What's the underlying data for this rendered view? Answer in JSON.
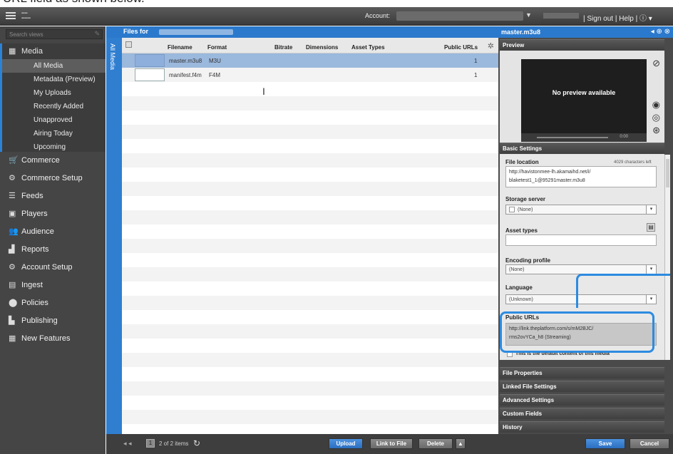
{
  "caption": "URL field as shown below.",
  "topbar": {
    "account_label": "Account:",
    "links": "| Sign out | Help | ⓘ ▾"
  },
  "sidebar": {
    "search_placeholder": "Search views",
    "media_label": "Media",
    "media_items": [
      {
        "label": "All Media",
        "active": true
      },
      {
        "label": "Metadata (Preview)"
      },
      {
        "label": "My Uploads"
      },
      {
        "label": "Recently Added"
      },
      {
        "label": "Unapproved"
      },
      {
        "label": "Airing Today"
      },
      {
        "label": "Upcoming"
      }
    ],
    "sections": [
      {
        "label": "Commerce",
        "icon": "cart-icon",
        "glyph": "🛒"
      },
      {
        "label": "Commerce Setup",
        "icon": "gear-icon",
        "glyph": "⚙"
      },
      {
        "label": "Feeds",
        "icon": "rss-icon",
        "glyph": "☰"
      },
      {
        "label": "Players",
        "icon": "player-icon",
        "glyph": "▣"
      },
      {
        "label": "Audience",
        "icon": "audience-icon",
        "glyph": "👥"
      },
      {
        "label": "Reports",
        "icon": "chart-icon",
        "glyph": "▟"
      },
      {
        "label": "Account Setup",
        "icon": "gear-icon",
        "glyph": "⚙"
      },
      {
        "label": "Ingest",
        "icon": "ingest-icon",
        "glyph": "▤"
      },
      {
        "label": "Policies",
        "icon": "policy-icon",
        "glyph": "⬤"
      },
      {
        "label": "Publishing",
        "icon": "publish-icon",
        "glyph": "▙"
      },
      {
        "label": "New Features",
        "icon": "features-icon",
        "glyph": "▦"
      }
    ]
  },
  "vertical_tab": "All Media",
  "files": {
    "header": "Files for",
    "columns": [
      "Filename",
      "Format",
      "Bitrate",
      "Dimensions",
      "Asset Types",
      "Public URLs"
    ],
    "rows": [
      {
        "filename": "master.m3u8",
        "format": "M3U",
        "urls": "1",
        "selected": true
      },
      {
        "filename": "manifest.f4m",
        "format": "F4M",
        "urls": "1",
        "selected": false
      }
    ],
    "pager": "2 of 2 items",
    "page": "1",
    "buttons": {
      "upload": "Upload",
      "link": "Link to File",
      "delete": "Delete"
    }
  },
  "right": {
    "title": "master.m3u8",
    "preview_label": "Preview",
    "no_preview": "No preview available",
    "player_time": "0:00",
    "basic_settings": "Basic Settings",
    "file_location_label": "File location",
    "chars_left": "4029 characters left",
    "file_location_value": "http://havistonmee-lh.akamaihd.net/i/ blaketest1_1@95291master.m3u8",
    "storage_label": "Storage server",
    "storage_value": "(None)",
    "asset_types_label": "Asset types",
    "encoding_label": "Encoding profile",
    "encoding_value": "(None)",
    "language_label": "Language",
    "language_value": "(Unknown)",
    "public_urls_label": "Public URLs",
    "public_url_1": "http://link.theplatform.com/s/mM2BJC/",
    "public_url_2": "rms2ovYCa_h8",
    "public_url_tail": " (Streaming)",
    "default_checkbox": "This is the default content of this media",
    "collapsed": [
      "File Properties",
      "Linked File Settings",
      "Advanced Settings",
      "Custom Fields",
      "History"
    ],
    "save": "Save",
    "cancel": "Cancel"
  },
  "colors": {
    "accent": "#2b79cc",
    "callout": "#2d8be0",
    "sidebar": "#454545"
  }
}
